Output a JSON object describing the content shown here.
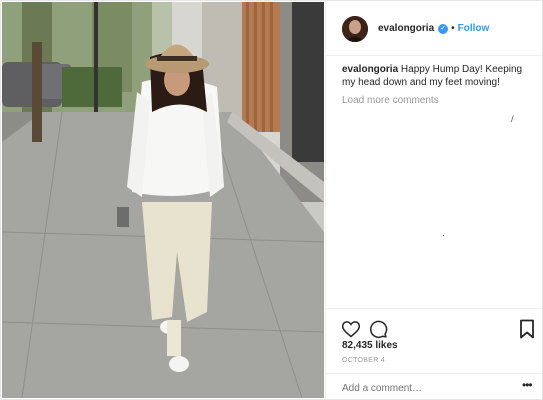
{
  "post": {
    "photo_icon": "street-photo",
    "header": {
      "username": "evalongoria",
      "verified_icon": "verified-badge-icon",
      "separator": "•",
      "follow_label": "Follow"
    },
    "caption": {
      "username": "evalongoria",
      "text": "Happy Hump Day! Keeping my head down and my feet moving!"
    },
    "load_more": "Load more comments",
    "stray_marks": [
      "/",
      "·"
    ],
    "actions": {
      "like_icon": "heart-icon",
      "comment_icon": "comment-icon",
      "save_icon": "bookmark-icon"
    },
    "likes": "82,435 likes",
    "date": "OCTOBER 4",
    "add_comment": {
      "placeholder": "Add a comment…",
      "more_label": "•••"
    }
  },
  "colors": {
    "accent": "#3897f0",
    "text": "#262626",
    "muted": "#999999",
    "border": "#efefef"
  }
}
